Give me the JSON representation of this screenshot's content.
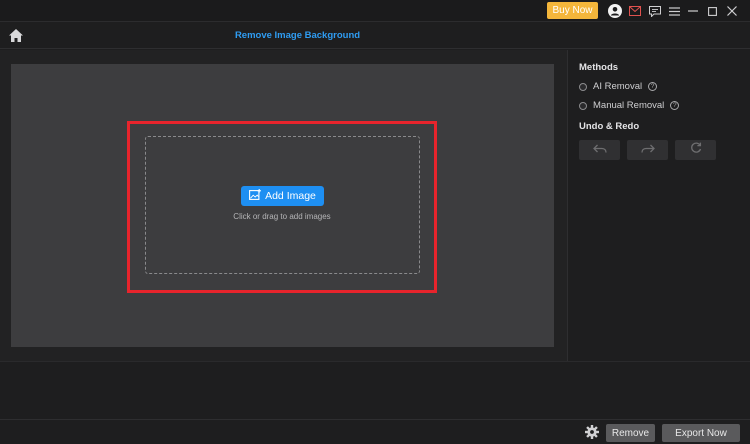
{
  "titlebar": {
    "buy_label": "Buy Now",
    "icons": [
      "account-icon",
      "mail-icon",
      "feedback-icon",
      "menu-icon",
      "minimize-icon",
      "maximize-icon",
      "close-icon"
    ]
  },
  "header": {
    "title": "Remove Image Background"
  },
  "dropzone": {
    "add_label": "Add Image",
    "hint": "Click or drag to add images",
    "highlight_color": "#e8242c"
  },
  "sidebar": {
    "methods_title": "Methods",
    "methods": [
      {
        "label": "AI Removal",
        "help": "?"
      },
      {
        "label": "Manual Removal",
        "help": "?"
      }
    ],
    "undo_title": "Undo & Redo",
    "undo_buttons": [
      "undo-icon",
      "redo-icon",
      "reset-icon"
    ]
  },
  "footer": {
    "remove_label": "Remove",
    "export_label": "Export Now"
  },
  "colors": {
    "accent": "#1e8ff2",
    "title_blue": "#2f9cf2",
    "buy": "#f4b63b"
  }
}
